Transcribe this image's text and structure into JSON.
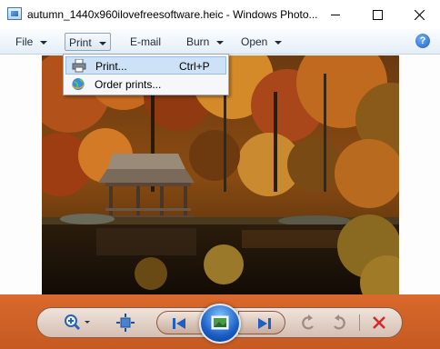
{
  "window": {
    "title": "autumn_1440x960ilovefreesoftware.heic - Windows Photo..."
  },
  "menubar": {
    "items": [
      {
        "label": "File",
        "has_arrow": true,
        "active": false
      },
      {
        "label": "Print",
        "has_arrow": true,
        "active": true
      },
      {
        "label": "E-mail",
        "has_arrow": false,
        "active": false
      },
      {
        "label": "Burn",
        "has_arrow": true,
        "active": false
      },
      {
        "label": "Open",
        "has_arrow": true,
        "active": false
      }
    ],
    "help_icon": "help-icon"
  },
  "print_menu": {
    "items": [
      {
        "label": "Print...",
        "shortcut": "Ctrl+P",
        "icon": "printer-icon",
        "highlighted": true
      },
      {
        "label": "Order prints...",
        "shortcut": "",
        "icon": "globe-icon",
        "highlighted": false
      }
    ]
  },
  "controls": {
    "icons": [
      "zoom-icon",
      "fit-to-window-icon",
      "previous-icon",
      "slideshow-icon",
      "next-icon",
      "rotate-counterclockwise-icon",
      "rotate-clockwise-icon",
      "delete-icon"
    ]
  },
  "colors": {
    "control_bar": "#d06228",
    "menu_highlight": "#cde1f7",
    "delete_red": "#d42a2a"
  }
}
